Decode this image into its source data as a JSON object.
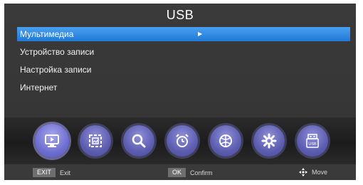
{
  "header": {
    "title": "USB"
  },
  "menu": {
    "items": [
      {
        "label": "Мультимедиа",
        "selected": true
      },
      {
        "label": "Устройство записи",
        "selected": false
      },
      {
        "label": "Настройка записи",
        "selected": false
      },
      {
        "label": "Интернет",
        "selected": false
      }
    ]
  },
  "dock": {
    "icons": [
      {
        "name": "media-player-icon",
        "active": true
      },
      {
        "name": "picture-icon",
        "active": false
      },
      {
        "name": "search-icon",
        "active": false
      },
      {
        "name": "alarm-clock-icon",
        "active": false
      },
      {
        "name": "globe-icon",
        "active": false
      },
      {
        "name": "settings-gear-icon",
        "active": false
      },
      {
        "name": "usb-icon",
        "active": false,
        "label": "USB"
      }
    ]
  },
  "footer": {
    "exit_key": "EXIT",
    "exit_label": "Exit",
    "ok_key": "OK",
    "ok_label": "Confirm",
    "move_label": "Move"
  },
  "colors": {
    "selection_blue": "#2b86e0",
    "dock_icon_purple": "#6e6ed0",
    "background_gray": "#3b3b3b"
  }
}
